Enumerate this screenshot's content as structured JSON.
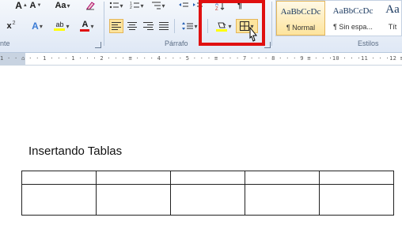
{
  "ribbon": {
    "font": {
      "grow_label": "A",
      "shrink_label": "A",
      "change_case_label": "Aa",
      "superscript_label": "x",
      "highlight_label": "ab",
      "font_color_label": "A",
      "group_label": "nte"
    },
    "paragraph": {
      "group_label": "Párrafo",
      "shading_icon": "paint-bucket-icon",
      "borders_icon": "borders-grid-icon"
    },
    "styles": {
      "group_label": "Estilos",
      "items": [
        {
          "preview": "AaBbCcDc",
          "name": "¶ Normal",
          "selected": true
        },
        {
          "preview": "AaBbCcDc",
          "name": "¶ Sin espa...",
          "selected": false
        },
        {
          "preview": "Aa",
          "name": "Tít",
          "selected": false
        }
      ]
    },
    "highlight_box_color": "#e01010"
  },
  "ruler": {
    "text": "1 · · ⌂ · · 1 · · · 1 · · · 2 · · · ≡ · · · 4 · · · 5 · · · ≡ · · · 7 · · · 8 · · · 9 ≡ · · ·10 · · ·11 · · ·12 ≡ ·13 · · ·14 · · ·15 · ≡ 1"
  },
  "document": {
    "heading": "Insertando Tablas",
    "table": {
      "rows": 2,
      "cols": 5
    }
  }
}
